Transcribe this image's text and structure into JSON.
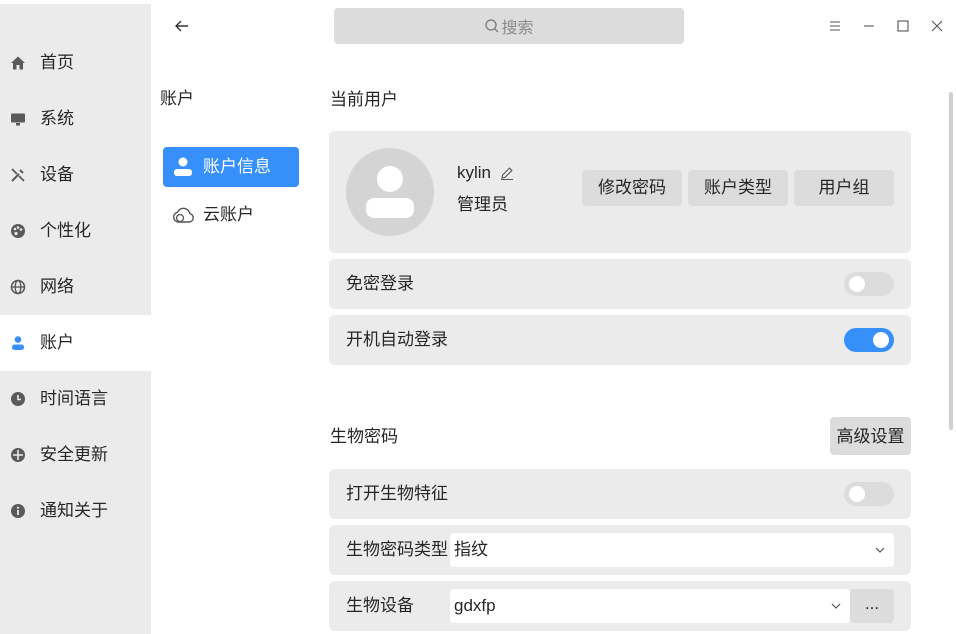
{
  "nav": {
    "items": [
      {
        "label": "首页",
        "icon": "home-icon"
      },
      {
        "label": "系统",
        "icon": "monitor-icon"
      },
      {
        "label": "设备",
        "icon": "tools-icon"
      },
      {
        "label": "个性化",
        "icon": "palette-icon"
      },
      {
        "label": "网络",
        "icon": "globe-icon"
      },
      {
        "label": "账户",
        "icon": "user-icon"
      },
      {
        "label": "时间语言",
        "icon": "clock-icon"
      },
      {
        "label": "安全更新",
        "icon": "shield-icon"
      },
      {
        "label": "通知关于",
        "icon": "info-icon"
      }
    ],
    "active_index": 5
  },
  "search": {
    "placeholder": "搜索"
  },
  "account_column": {
    "title": "账户",
    "items": [
      {
        "label": "账户信息",
        "icon": "user-icon"
      },
      {
        "label": "云账户",
        "icon": "cloud-icon"
      }
    ]
  },
  "current_user": {
    "section_title": "当前用户",
    "username": "kylin",
    "role": "管理员",
    "buttons": {
      "change_password": "修改密码",
      "account_type": "账户类型",
      "user_group": "用户组"
    }
  },
  "login_options": {
    "passwordless_login": {
      "label": "免密登录",
      "enabled": false
    },
    "auto_login": {
      "label": "开机自动登录",
      "enabled": true
    }
  },
  "biometrics": {
    "section_title": "生物密码",
    "advanced_settings_label": "高级设置",
    "enable_biometrics": {
      "label": "打开生物特征",
      "enabled": false
    },
    "type": {
      "label": "生物密码类型",
      "value": "指纹"
    },
    "device": {
      "label": "生物设备",
      "value": "gdxfp",
      "more_label": "..."
    }
  },
  "colors": {
    "accent": "#3790fa",
    "nav_bg": "#ebebeb",
    "card_bg": "#ebebeb",
    "button_bg": "#dcdcdc"
  }
}
